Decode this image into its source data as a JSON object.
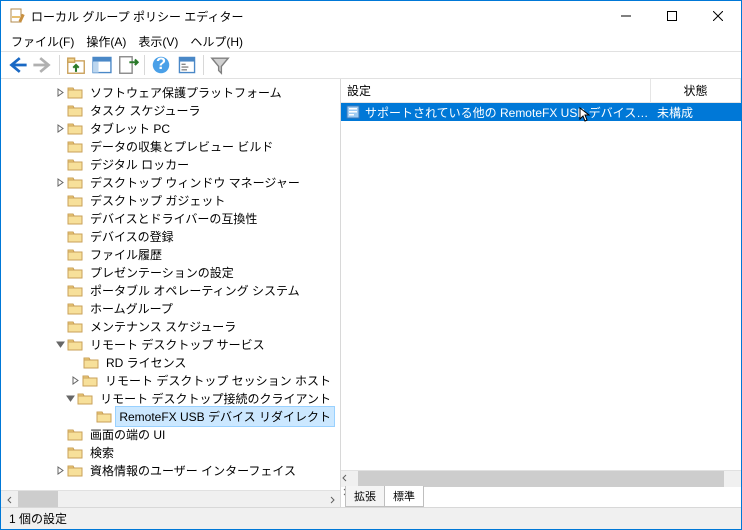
{
  "window": {
    "title": "ローカル グループ ポリシー エディター"
  },
  "menu": {
    "file": "ファイル(F)",
    "action": "操作(A)",
    "view": "表示(V)",
    "help": "ヘルプ(H)"
  },
  "tree": [
    {
      "indent": 3,
      "expand": "closed",
      "label": "ソフトウェア保護プラットフォーム"
    },
    {
      "indent": 3,
      "expand": "none",
      "label": "タスク スケジューラ"
    },
    {
      "indent": 3,
      "expand": "closed",
      "label": "タブレット PC"
    },
    {
      "indent": 3,
      "expand": "none",
      "label": "データの収集とプレビュー ビルド"
    },
    {
      "indent": 3,
      "expand": "none",
      "label": "デジタル ロッカー"
    },
    {
      "indent": 3,
      "expand": "closed",
      "label": "デスクトップ ウィンドウ マネージャー"
    },
    {
      "indent": 3,
      "expand": "none",
      "label": "デスクトップ ガジェット"
    },
    {
      "indent": 3,
      "expand": "none",
      "label": "デバイスとドライバーの互換性"
    },
    {
      "indent": 3,
      "expand": "none",
      "label": "デバイスの登録"
    },
    {
      "indent": 3,
      "expand": "none",
      "label": "ファイル履歴"
    },
    {
      "indent": 3,
      "expand": "none",
      "label": "プレゼンテーションの設定"
    },
    {
      "indent": 3,
      "expand": "none",
      "label": "ポータブル オペレーティング システム"
    },
    {
      "indent": 3,
      "expand": "none",
      "label": "ホームグループ"
    },
    {
      "indent": 3,
      "expand": "none",
      "label": "メンテナンス スケジューラ"
    },
    {
      "indent": 3,
      "expand": "open",
      "label": "リモート デスクトップ サービス"
    },
    {
      "indent": 4,
      "expand": "none",
      "label": "RD ライセンス"
    },
    {
      "indent": 4,
      "expand": "closed",
      "label": "リモート デスクトップ セッション ホスト"
    },
    {
      "indent": 4,
      "expand": "open",
      "label": "リモート デスクトップ接続のクライアント"
    },
    {
      "indent": 5,
      "expand": "none",
      "label": "RemoteFX USB デバイス リダイレクト",
      "selected": true
    },
    {
      "indent": 3,
      "expand": "none",
      "label": "画面の端の UI"
    },
    {
      "indent": 3,
      "expand": "none",
      "label": "検索"
    },
    {
      "indent": 3,
      "expand": "closed",
      "label": "資格情報のユーザー インターフェイス"
    }
  ],
  "list": {
    "headers": {
      "setting": "設定",
      "state": "状態"
    },
    "rows": [
      {
        "setting": "サポートされている他の RemoteFX USB デバイスの、この...",
        "state": "未構成",
        "selected": true
      }
    ]
  },
  "tabs": {
    "extended": "拡張",
    "standard": "標準"
  },
  "status": {
    "text": "1 個の設定"
  }
}
